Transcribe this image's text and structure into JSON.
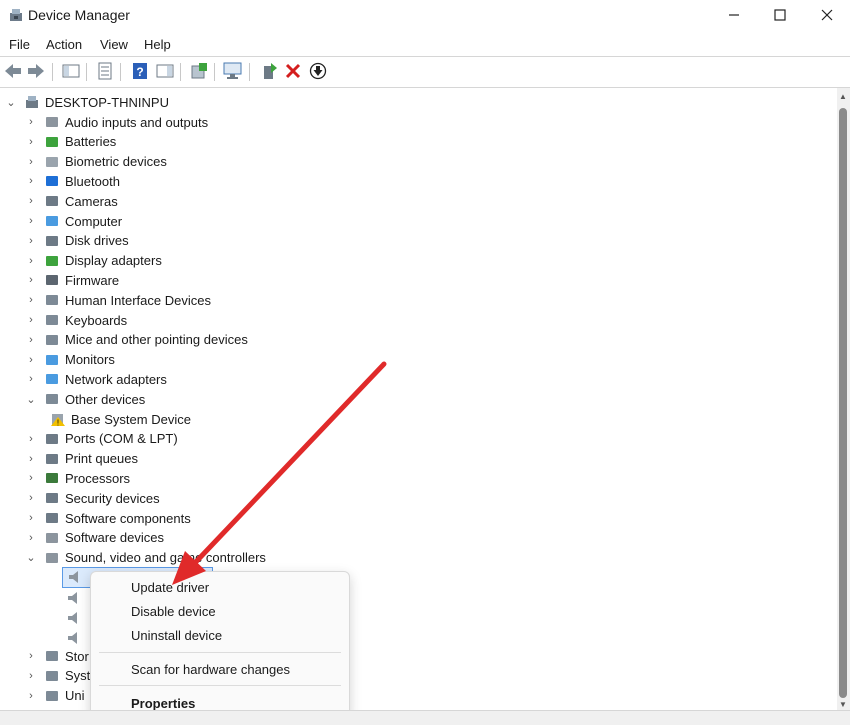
{
  "window": {
    "title": "Device Manager",
    "controls": {
      "minimize": "—",
      "maximize": "☐",
      "close": "✕"
    }
  },
  "menu": [
    "File",
    "Action",
    "View",
    "Help"
  ],
  "toolbar": {
    "buttons": [
      "back-icon",
      "forward-icon",
      "console-tree-icon",
      "properties-icon",
      "help-icon",
      "action-pane-icon",
      "update-driver-icon",
      "scan-hardware-icon",
      "enable-device-icon",
      "uninstall-device-icon",
      "disable-device-icon"
    ],
    "uninstall_color": "#d41e1e"
  },
  "tree": {
    "root": "DESKTOP-THNINPU",
    "categories": [
      {
        "label": "Audio inputs and outputs",
        "expander": "›"
      },
      {
        "label": "Batteries",
        "expander": "›"
      },
      {
        "label": "Biometric devices",
        "expander": "›"
      },
      {
        "label": "Bluetooth",
        "expander": "›"
      },
      {
        "label": "Cameras",
        "expander": "›"
      },
      {
        "label": "Computer",
        "expander": "›"
      },
      {
        "label": "Disk drives",
        "expander": "›"
      },
      {
        "label": "Display adapters",
        "expander": "›"
      },
      {
        "label": "Firmware",
        "expander": "›"
      },
      {
        "label": "Human Interface Devices",
        "expander": "›"
      },
      {
        "label": "Keyboards",
        "expander": "›"
      },
      {
        "label": "Mice and other pointing devices",
        "expander": "›"
      },
      {
        "label": "Monitors",
        "expander": "›"
      },
      {
        "label": "Network adapters",
        "expander": "›"
      },
      {
        "label": "Other devices",
        "expander": "⌄"
      },
      {
        "label": "Base System Device",
        "child": true
      },
      {
        "label": "Ports (COM & LPT)",
        "expander": "›"
      },
      {
        "label": "Print queues",
        "expander": "›"
      },
      {
        "label": "Processors",
        "expander": "›"
      },
      {
        "label": "Security devices",
        "expander": "›"
      },
      {
        "label": "Software components",
        "expander": "›"
      },
      {
        "label": "Software devices",
        "expander": "›"
      },
      {
        "label": "Sound, video and game controllers",
        "expander": "⌄"
      }
    ],
    "partial": [
      {
        "label": "Stor",
        "expander": "›"
      },
      {
        "label": "Syst",
        "expander": "›"
      },
      {
        "label": "Uni",
        "expander": "›"
      }
    ]
  },
  "context_menu": {
    "items": [
      "Update driver",
      "Disable device",
      "Uninstall device",
      "Scan for hardware changes",
      "Properties"
    ]
  },
  "annotation": {
    "arrow_color": "#e02a2a"
  }
}
